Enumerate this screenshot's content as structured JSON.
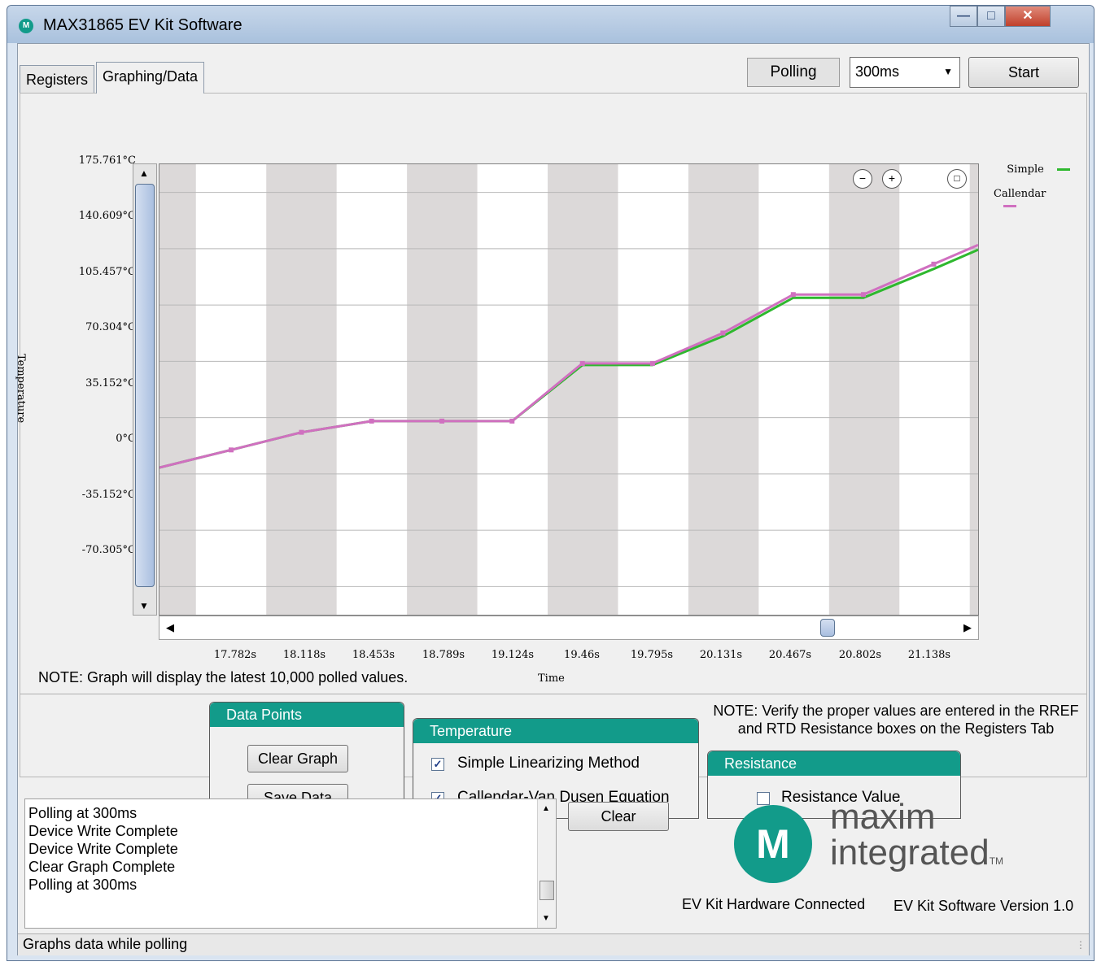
{
  "window": {
    "title": "MAX31865 EV Kit Software",
    "icon_text": "M"
  },
  "tabs": [
    {
      "label": "Registers"
    },
    {
      "label": "Graphing/Data"
    }
  ],
  "toolbar": {
    "polling_label": "Polling",
    "interval": "300ms",
    "start_label": "Start"
  },
  "graph": {
    "y_axis_title": "Temperature",
    "x_axis_title": "Time",
    "y_ticks": [
      "175.761°C",
      "140.609°C",
      "105.457°C",
      "70.304°C",
      "35.152°C",
      "0°C",
      "-35.152°C",
      "-70.305°C"
    ],
    "x_ticks": [
      "17.782s",
      "18.118s",
      "18.453s",
      "18.789s",
      "19.124s",
      "19.46s",
      "19.795s",
      "20.131s",
      "20.467s",
      "20.802s",
      "21.138s"
    ],
    "legend": [
      {
        "name": "Simple",
        "color": "#2eb82e"
      },
      {
        "name": "Callendar",
        "color": "#d070c0"
      }
    ],
    "note": "NOTE: Graph will display the latest 10,000 polled values."
  },
  "chart_data": {
    "type": "line",
    "xlabel": "Time",
    "ylabel": "Temperature",
    "ylim": [
      -87.88,
      193.34
    ],
    "x": [
      17.44,
      17.782,
      18.118,
      18.453,
      18.789,
      19.124,
      19.46,
      19.795,
      20.131,
      20.467,
      20.802,
      21.138,
      21.35
    ],
    "series": [
      {
        "name": "Simple",
        "color": "#2eb82e",
        "values": [
          4,
          15,
          26,
          33,
          33,
          33,
          68,
          68,
          86,
          110,
          110,
          128,
          140
        ]
      },
      {
        "name": "Callendar",
        "color": "#d070c0",
        "values": [
          4,
          15,
          26,
          33,
          33,
          33,
          69,
          69,
          88,
          112,
          112,
          131,
          143
        ]
      }
    ],
    "grid": true,
    "legend": "top-right"
  },
  "data_points": {
    "title": "Data Points",
    "clear_graph": "Clear Graph",
    "save_data": "Save Data"
  },
  "temperature": {
    "title": "Temperature",
    "simple_label": "Simple Linearizing Method",
    "callendar_label": "Callendar-Van Dusen Equation",
    "simple_checked": true,
    "callendar_checked": true
  },
  "resistance": {
    "title": "Resistance",
    "value_label": "Resistance Value",
    "checked": false,
    "note_line1": "NOTE: Verify the proper values are entered in the RREF",
    "note_line2": "and RTD Resistance boxes on the Registers Tab"
  },
  "log": {
    "lines": [
      "Polling at 300ms",
      "Device Write Complete",
      "Device Write Complete",
      "Clear Graph Complete",
      "Polling at 300ms"
    ],
    "clear_label": "Clear"
  },
  "brand": {
    "logo_line1": "maxim",
    "logo_line2": "integrated",
    "tm": "TM",
    "logo_mark": "M"
  },
  "status": {
    "hardware": "EV Kit Hardware Connected",
    "version": "EV Kit Software Version 1.0",
    "bar_text": "Graphs data while polling"
  }
}
